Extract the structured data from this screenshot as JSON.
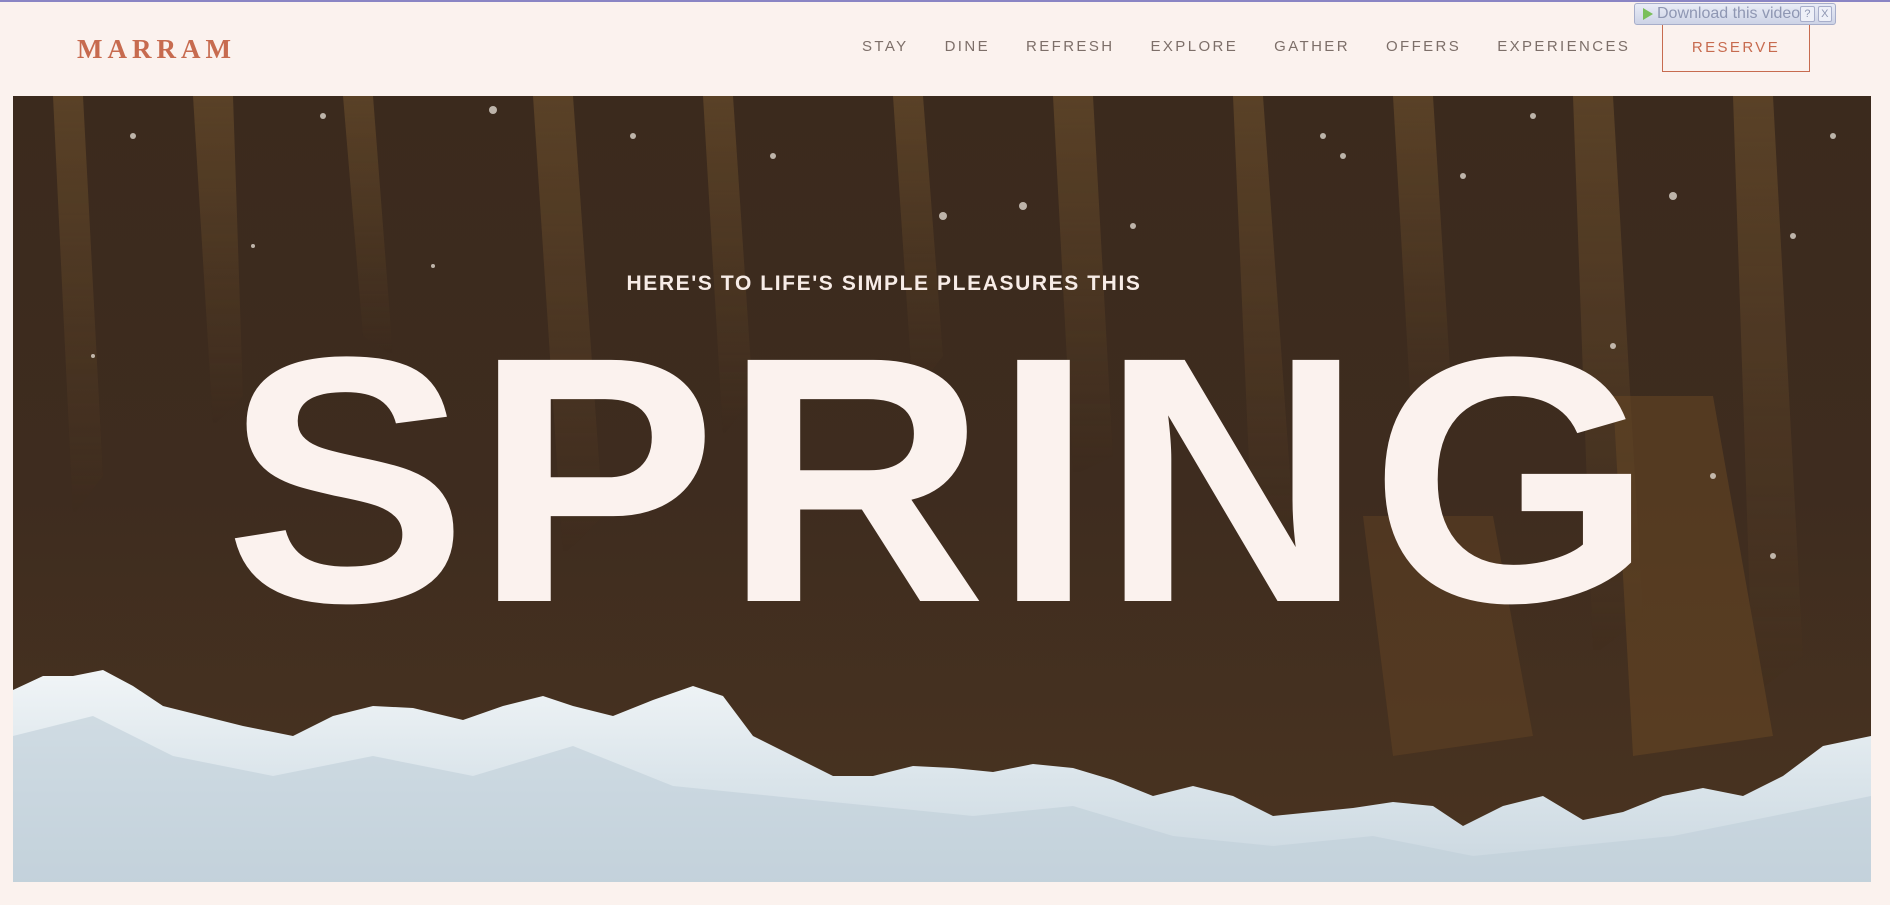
{
  "brand": {
    "logo": "MARRAM"
  },
  "nav": {
    "items": [
      {
        "id": "stay",
        "label": "STAY"
      },
      {
        "id": "dine",
        "label": "DINE"
      },
      {
        "id": "refresh",
        "label": "REFRESH"
      },
      {
        "id": "explore",
        "label": "EXPLORE"
      },
      {
        "id": "gather",
        "label": "GATHER"
      },
      {
        "id": "offers",
        "label": "OFFERS"
      },
      {
        "id": "experiences",
        "label": "EXPERIENCES"
      }
    ],
    "reserve_label": "RESERVE"
  },
  "download_bar": {
    "label": "Download this video",
    "help": "?",
    "close": "X"
  },
  "hero": {
    "kicker": "HERE'S TO LIFE'S SIMPLE PLEASURES THIS",
    "headline": "SPRING"
  },
  "colors": {
    "background": "#fbf2ee",
    "accent": "#c76b4f",
    "nav_text": "#7d6f69",
    "sand_dark": "#3a2a1e",
    "foam": "#dfe8ee"
  }
}
